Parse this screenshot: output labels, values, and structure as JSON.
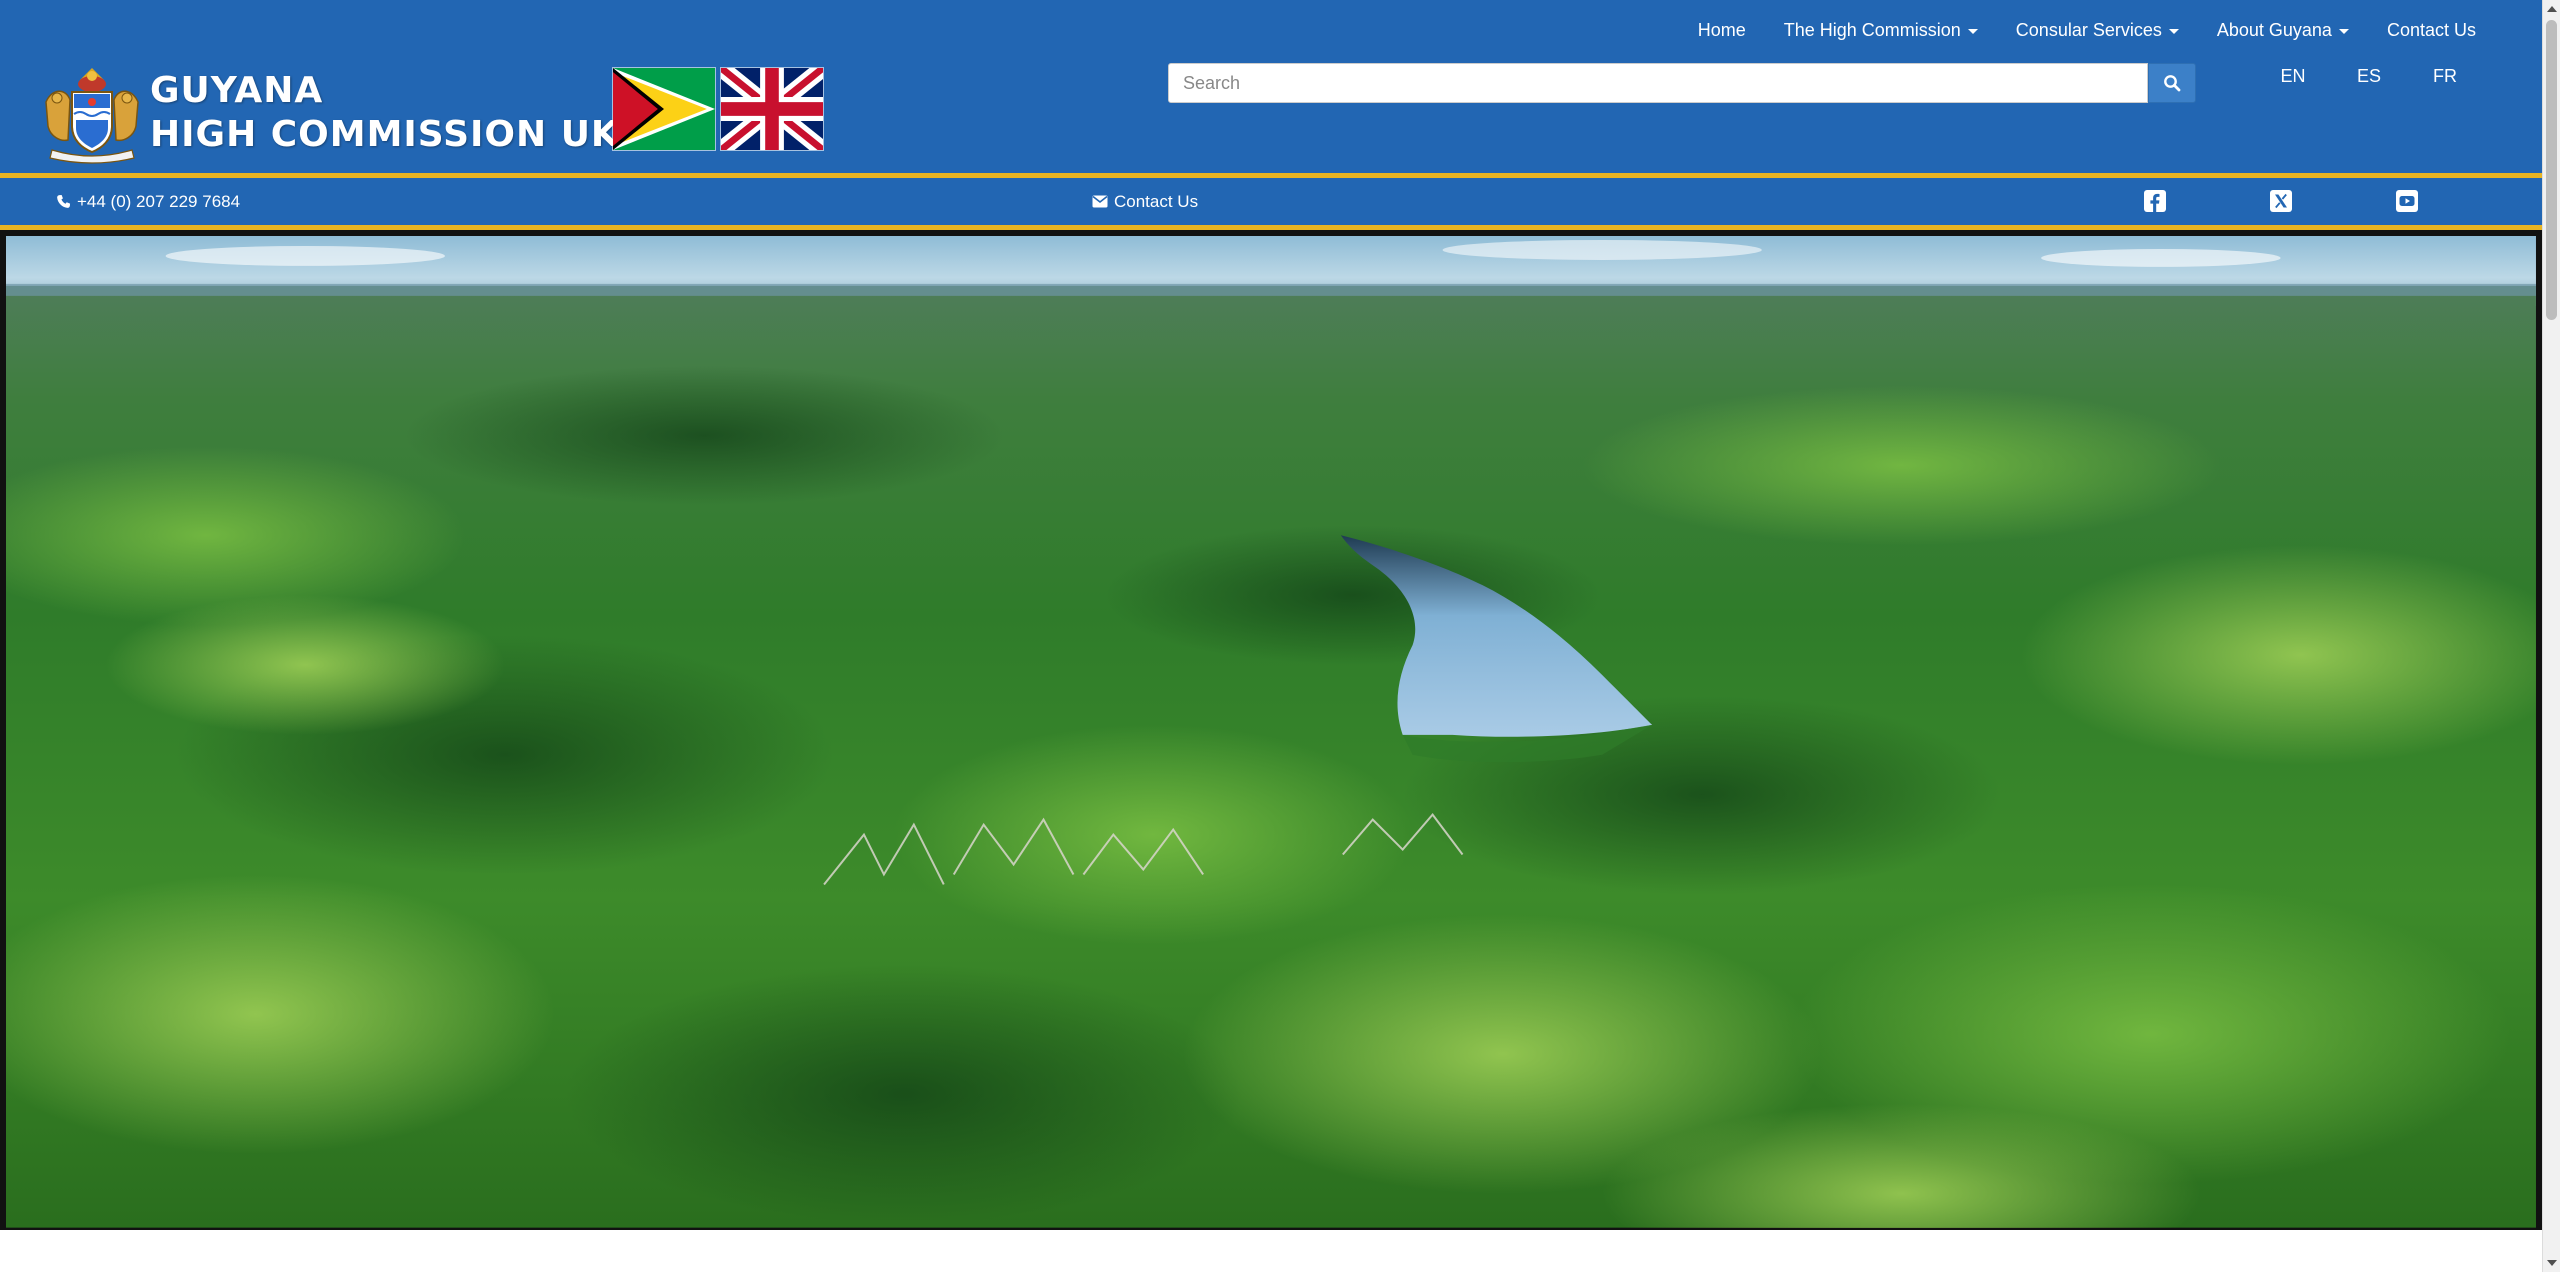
{
  "brand": {
    "line1": "GUYANA",
    "line2": "HIGH COMMISSION UK"
  },
  "nav": {
    "home": "Home",
    "high_commission": "The High Commission",
    "consular": "Consular Services",
    "about": "About Guyana",
    "contact": "Contact Us"
  },
  "search": {
    "placeholder": "Search"
  },
  "languages": [
    "EN",
    "ES",
    "FR"
  ],
  "contact_bar": {
    "phone": "+44 (0) 207 229 7684",
    "contact": "Contact Us"
  },
  "colors": {
    "header_blue": "#2266b3",
    "gold": "#e8b423"
  },
  "icons": {
    "phone": "phone-icon",
    "envelope": "envelope-icon",
    "facebook": "facebook-icon",
    "x": "x-twitter-icon",
    "youtube": "youtube-icon",
    "search": "search-icon"
  }
}
